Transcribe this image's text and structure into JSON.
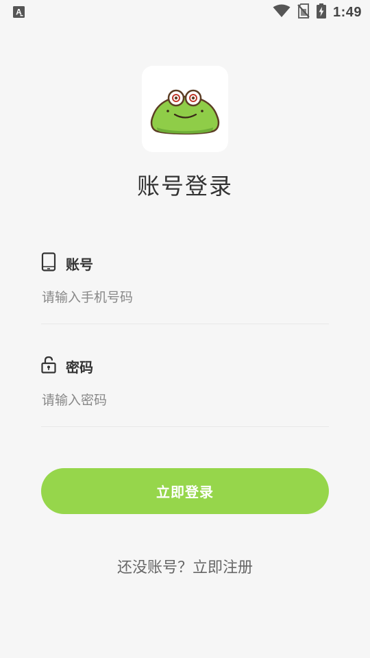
{
  "status_bar": {
    "time": "1:49",
    "notification_icon": "font-a-icon",
    "wifi_icon": "wifi-icon",
    "sim_icon": "no-sim-icon",
    "battery_icon": "battery-charging-icon"
  },
  "logo": {
    "icon": "frog-logo-icon"
  },
  "title": "账号登录",
  "account_field": {
    "label": "账号",
    "icon": "phone-icon",
    "placeholder": "请输入手机号码",
    "value": ""
  },
  "password_field": {
    "label": "密码",
    "icon": "lock-icon",
    "placeholder": "请输入密码",
    "value": ""
  },
  "login_button": {
    "label": "立即登录"
  },
  "register_link": {
    "label": "还没账号？立即注册"
  },
  "colors": {
    "accent": "#96d64b",
    "background": "#f6f6f6",
    "text_primary": "#333333",
    "text_secondary": "#666666",
    "placeholder": "#888888"
  }
}
